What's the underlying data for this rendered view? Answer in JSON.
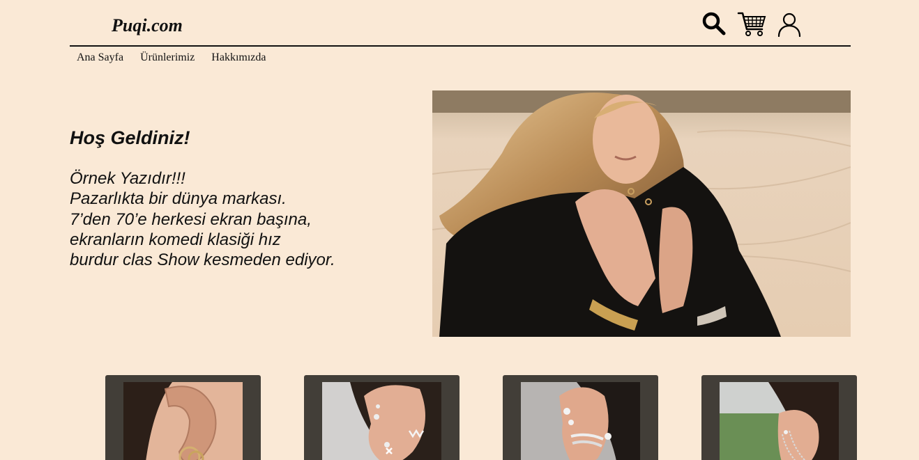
{
  "header": {
    "logo": "Puqi.com",
    "icons": [
      "search-icon",
      "cart-icon",
      "user-icon"
    ]
  },
  "nav": {
    "items": [
      "Ana Sayfa",
      "Ürünlerimiz",
      "Hakkımızda"
    ]
  },
  "hero": {
    "title": "Hoş Geldiniz!",
    "lines": [
      "Örnek Yazıdır!!!",
      "Pazarlıkta bir dünya markası.",
      "7’den 70’e herkesi ekran başına,",
      "ekranların komedi klasiği hız",
      "burdur clas Show kesmeden ediyor."
    ]
  },
  "products": {
    "count": 4
  },
  "colors": {
    "background": "#fae9d6",
    "card": "#423e38",
    "text": "#111111"
  }
}
